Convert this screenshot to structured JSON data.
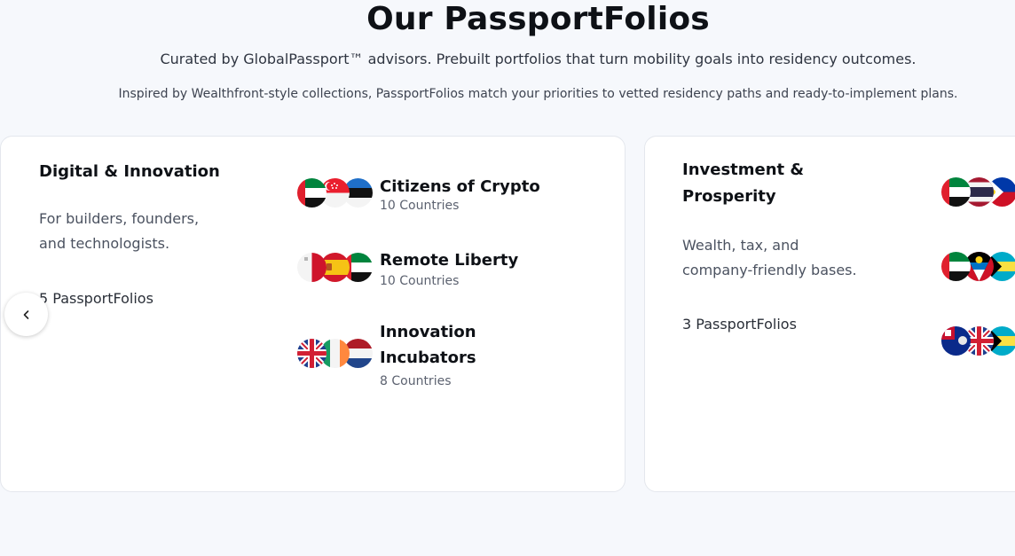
{
  "header": {
    "title": "Our PassportFolios",
    "subtitle": "Curated by GlobalPassport™ advisors. Prebuilt portfolios that turn mobility goals into residency outcomes.",
    "description": "Inspired by Wealthfront-style collections, PassportFolios match your priorities to vetted residency paths and ready-to-implement plans."
  },
  "categories": [
    {
      "title": "Digital & Innovation",
      "description_line1": "For builders, founders,",
      "description_line2": "and technologists.",
      "count": "5 PassportFolios",
      "folios": [
        {
          "name": "Citizens of Crypto",
          "countries": "10 Countries",
          "flags": [
            "uae-flag-icon",
            "singapore-flag-icon",
            "estonia-flag-icon"
          ]
        },
        {
          "name": "Remote Liberty",
          "countries": "10 Countries",
          "flags": [
            "malta-flag-icon",
            "spain-flag-icon",
            "uae-flag-icon"
          ]
        },
        {
          "name_line1": "Innovation",
          "name_line2": "Incubators",
          "countries": "8 Countries",
          "flags": [
            "uk-flag-icon",
            "ireland-flag-icon",
            "netherlands-flag-icon"
          ]
        }
      ]
    },
    {
      "title_line1": "Investment &",
      "title_line2": "Prosperity",
      "description_line1": "Wealth, tax, and",
      "description_line2": "company-friendly bases.",
      "count": "3 PassportFolios",
      "folios": [
        {
          "flags": [
            "uae-flag-icon",
            "thailand-flag-icon",
            "philippines-flag-icon"
          ]
        },
        {
          "flags": [
            "uae-flag-icon",
            "antigua-flag-icon",
            "bahamas-flag-icon"
          ]
        },
        {
          "flags": [
            "cayman-flag-icon",
            "uk-flag-icon",
            "bahamas-flag-icon"
          ]
        }
      ]
    }
  ],
  "carousel": {
    "prev_icon": "chevron-left-icon"
  },
  "colors": {
    "background": "#f6f8fc",
    "card": "#ffffff",
    "text": "#0e1116",
    "muted": "#4b5260"
  }
}
